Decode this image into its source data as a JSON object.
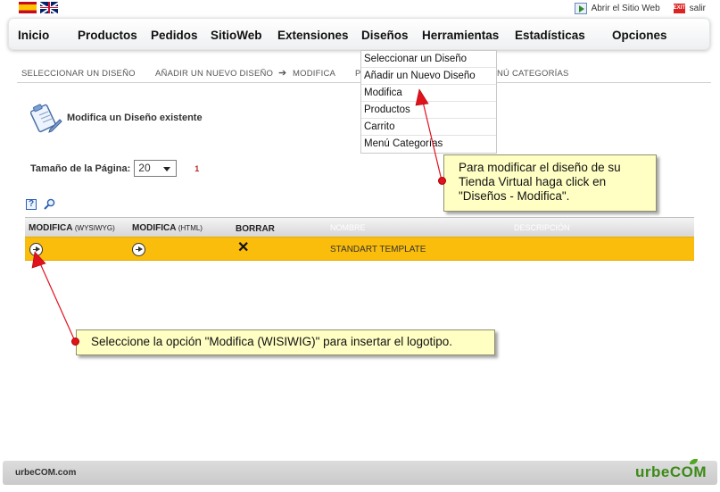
{
  "top": {
    "languages": [
      "es",
      "en"
    ],
    "open_site_label": "Abrir el Sitio Web",
    "exit_label": "salir",
    "exit_icon_text": "EXIT"
  },
  "menu": {
    "items": [
      {
        "label": "Inicio"
      },
      {
        "label": "Productos"
      },
      {
        "label": "Pedidos"
      },
      {
        "label": "SitioWeb"
      },
      {
        "label": "Extensiones"
      },
      {
        "label": "Diseños"
      },
      {
        "label": "Herramientas"
      },
      {
        "label": "Estadísticas"
      },
      {
        "label": "Opciones"
      }
    ],
    "dropdown": [
      {
        "label": "Seleccionar un Diseño"
      },
      {
        "label": "Añadir un Nuevo Diseño"
      },
      {
        "label": "Modifica"
      },
      {
        "label": "Productos"
      },
      {
        "label": "Carrito"
      },
      {
        "label": "Menú Categorías"
      }
    ]
  },
  "subnav": {
    "select": "SELECCIONAR UN DISEÑO",
    "add": "AñADIR UN NUEVO DISEÑO",
    "arrow": "➔",
    "modify": "MODIFICA",
    "products_fragment": "P",
    "categories_fragment": "Nú CATEGORíAS"
  },
  "page": {
    "title": "Modifica un Diseño existente",
    "page_size_label": "Tamaño de la Página:",
    "page_size_value": "20",
    "page_number": "1",
    "help_glyph": "?"
  },
  "table": {
    "columns": {
      "wysiwyg": "MODIFICA",
      "wysiwyg_small": "(WYSIWYG)",
      "html": "MODIFICA",
      "html_small": "(HTML)",
      "delete": "BORRAR",
      "name": "NOMBRE",
      "description": "DESCRIPCIÓN"
    },
    "rows": [
      {
        "name": "STANDART TEMPLATE",
        "delete_glyph": "✕"
      }
    ]
  },
  "callouts": {
    "menu_hint": "Para modificar el diseño de su Tienda Virtual haga click en \"Diseños - Modifica\".",
    "row_hint": "Seleccione la opción \"Modifica (WISIWIG)\" para insertar el logotipo."
  },
  "footer": {
    "site": "urbeCOM.com",
    "logo": "urbeCOM"
  },
  "colors": {
    "row_highlight": "#fbbd0b",
    "callout_bg": "#ffffc4",
    "arrow_red": "#e0121e",
    "logo_green": "#3c8a17"
  }
}
